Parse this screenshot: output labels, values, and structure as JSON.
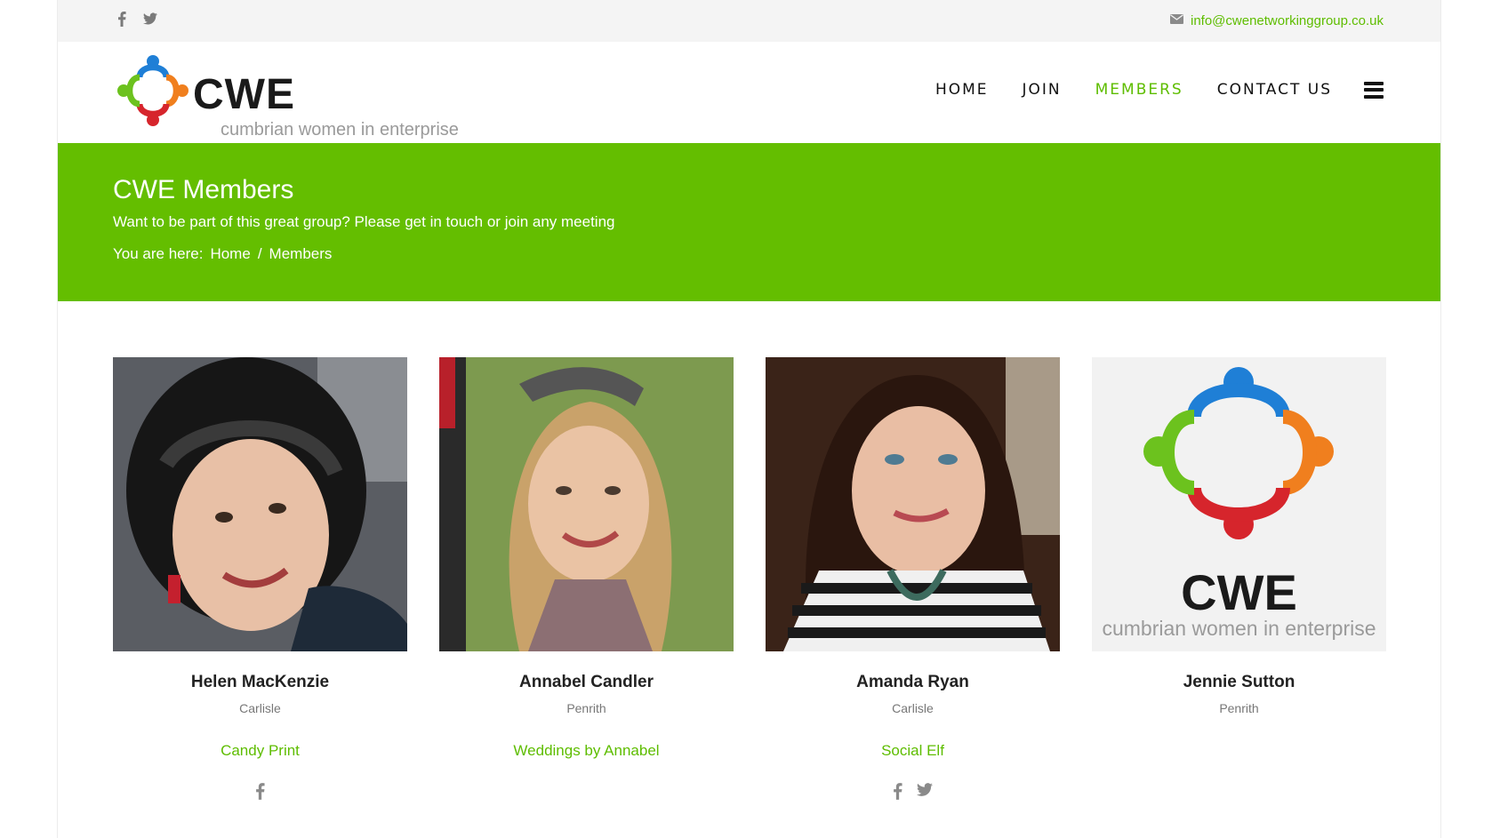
{
  "topbar": {
    "social_icons": [
      "facebook-icon",
      "twitter-icon"
    ],
    "email_icon": "envelope-icon",
    "email": "info@cwenetworkinggroup.co.uk"
  },
  "header": {
    "logo_text": "CWE",
    "logo_tagline": "cumbrian women in enterprise",
    "nav": [
      {
        "label": "HOME",
        "active": false
      },
      {
        "label": "JOIN",
        "active": false
      },
      {
        "label": "MEMBERS",
        "active": true
      },
      {
        "label": "CONTACT US",
        "active": false
      }
    ],
    "menu_icon": "hamburger-icon"
  },
  "banner": {
    "title": "CWE Members",
    "subtitle": "Want to be part of this great group? Please get in touch or join any meeting",
    "crumb_prefix": "You are here:",
    "crumb_home": "Home",
    "crumb_sep": "/",
    "crumb_current": "Members"
  },
  "members": [
    {
      "name": "Helen MacKenzie",
      "town": "Carlisle",
      "business": "Candy Print",
      "social": [
        "facebook-icon"
      ]
    },
    {
      "name": "Annabel Candler",
      "town": "Penrith",
      "business": "Weddings by Annabel",
      "social": []
    },
    {
      "name": "Amanda Ryan",
      "town": "Carlisle",
      "business": "Social Elf",
      "social": [
        "facebook-icon",
        "twitter-icon"
      ]
    },
    {
      "name": "Jennie Sutton",
      "town": "Penrith",
      "business": "",
      "social": []
    }
  ],
  "colors": {
    "accent": "#64be00",
    "link": "#5ebd00",
    "topbar_bg": "#f4f4f4"
  }
}
